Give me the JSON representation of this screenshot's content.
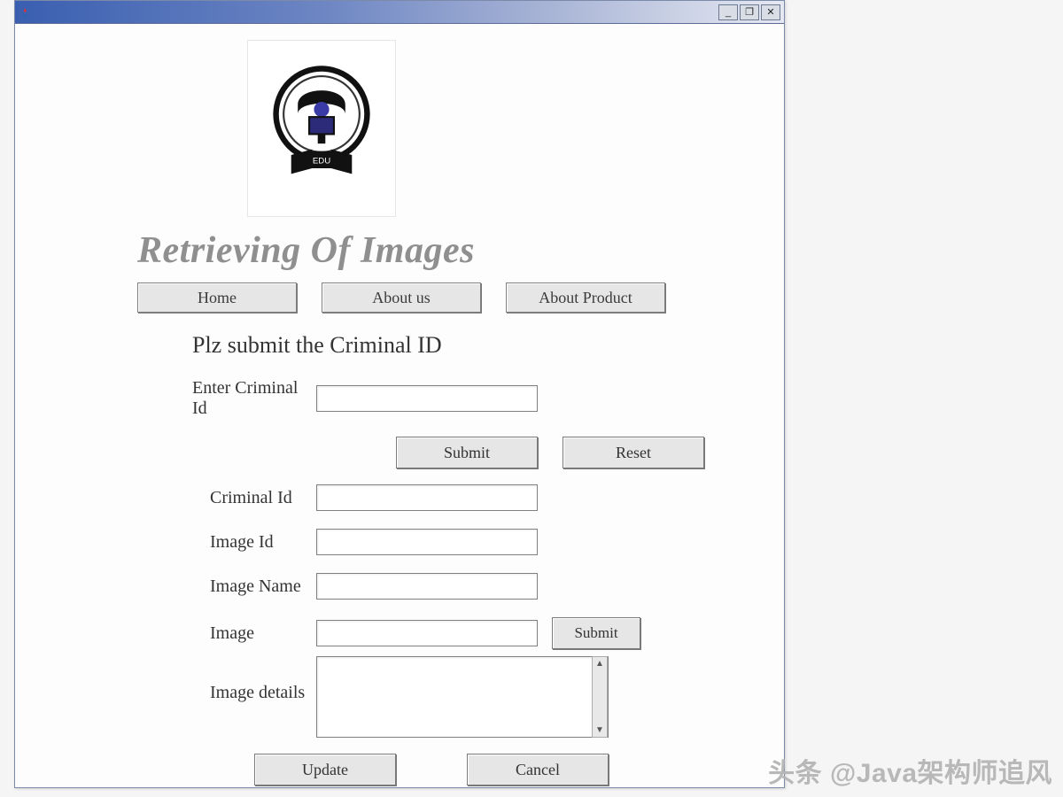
{
  "window": {
    "minimize": "_",
    "maximize": "❐",
    "close": "✕"
  },
  "page": {
    "title": "Retrieving Of Images",
    "subtitle": "Plz submit the Criminal ID"
  },
  "nav": {
    "home": "Home",
    "about_us": "About us",
    "about_product": "About Product"
  },
  "form": {
    "enter_criminal_id_label": "Enter Criminal Id",
    "enter_criminal_id_value": "",
    "submit_label": "Submit",
    "reset_label": "Reset",
    "criminal_id_label": "Criminal Id",
    "criminal_id_value": "",
    "image_id_label": "Image Id",
    "image_id_value": "",
    "image_name_label": "Image Name",
    "image_name_value": "",
    "image_label": "Image",
    "image_value": "",
    "side_submit_label": "Submit",
    "image_details_label": "Image details",
    "image_details_value": "",
    "update_label": "Update",
    "cancel_label": "Cancel"
  },
  "watermark": "头条 @Java架构师追风"
}
